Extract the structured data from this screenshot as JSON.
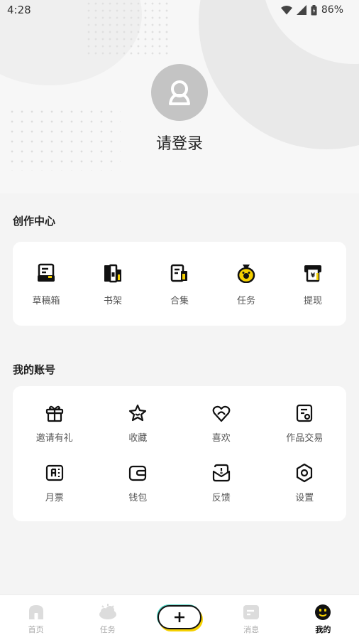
{
  "status_bar": {
    "time": "4:28",
    "battery": "86%"
  },
  "profile": {
    "login_label": "请登录"
  },
  "creation_center": {
    "title": "创作中心",
    "items": [
      {
        "label": "草稿箱",
        "icon": "drafts-icon"
      },
      {
        "label": "书架",
        "icon": "bookshelf-icon"
      },
      {
        "label": "合集",
        "icon": "collection-icon"
      },
      {
        "label": "任务",
        "icon": "task-bag-icon"
      },
      {
        "label": "提现",
        "icon": "withdraw-icon"
      }
    ]
  },
  "my_account": {
    "title": "我的账号",
    "items": [
      {
        "label": "邀请有礼",
        "icon": "gift-icon"
      },
      {
        "label": "收藏",
        "icon": "star-icon"
      },
      {
        "label": "喜欢",
        "icon": "heart-icon"
      },
      {
        "label": "作品交易",
        "icon": "trade-doc-icon"
      },
      {
        "label": "月票",
        "icon": "monthly-ticket-icon"
      },
      {
        "label": "钱包",
        "icon": "wallet-icon"
      },
      {
        "label": "反馈",
        "icon": "feedback-icon"
      },
      {
        "label": "设置",
        "icon": "settings-icon"
      }
    ]
  },
  "bottom_nav": {
    "items": [
      {
        "label": "首页",
        "icon": "home-icon",
        "active": false
      },
      {
        "label": "任务",
        "icon": "cloud-task-icon",
        "active": false
      },
      {
        "label": "",
        "icon": "plus-icon",
        "active": false
      },
      {
        "label": "消息",
        "icon": "message-icon",
        "active": false
      },
      {
        "label": "我的",
        "icon": "profile-face-icon",
        "active": true
      }
    ]
  },
  "colors": {
    "accent": "#f5d000",
    "accent2": "#4fd6c4",
    "dark": "#111111"
  }
}
